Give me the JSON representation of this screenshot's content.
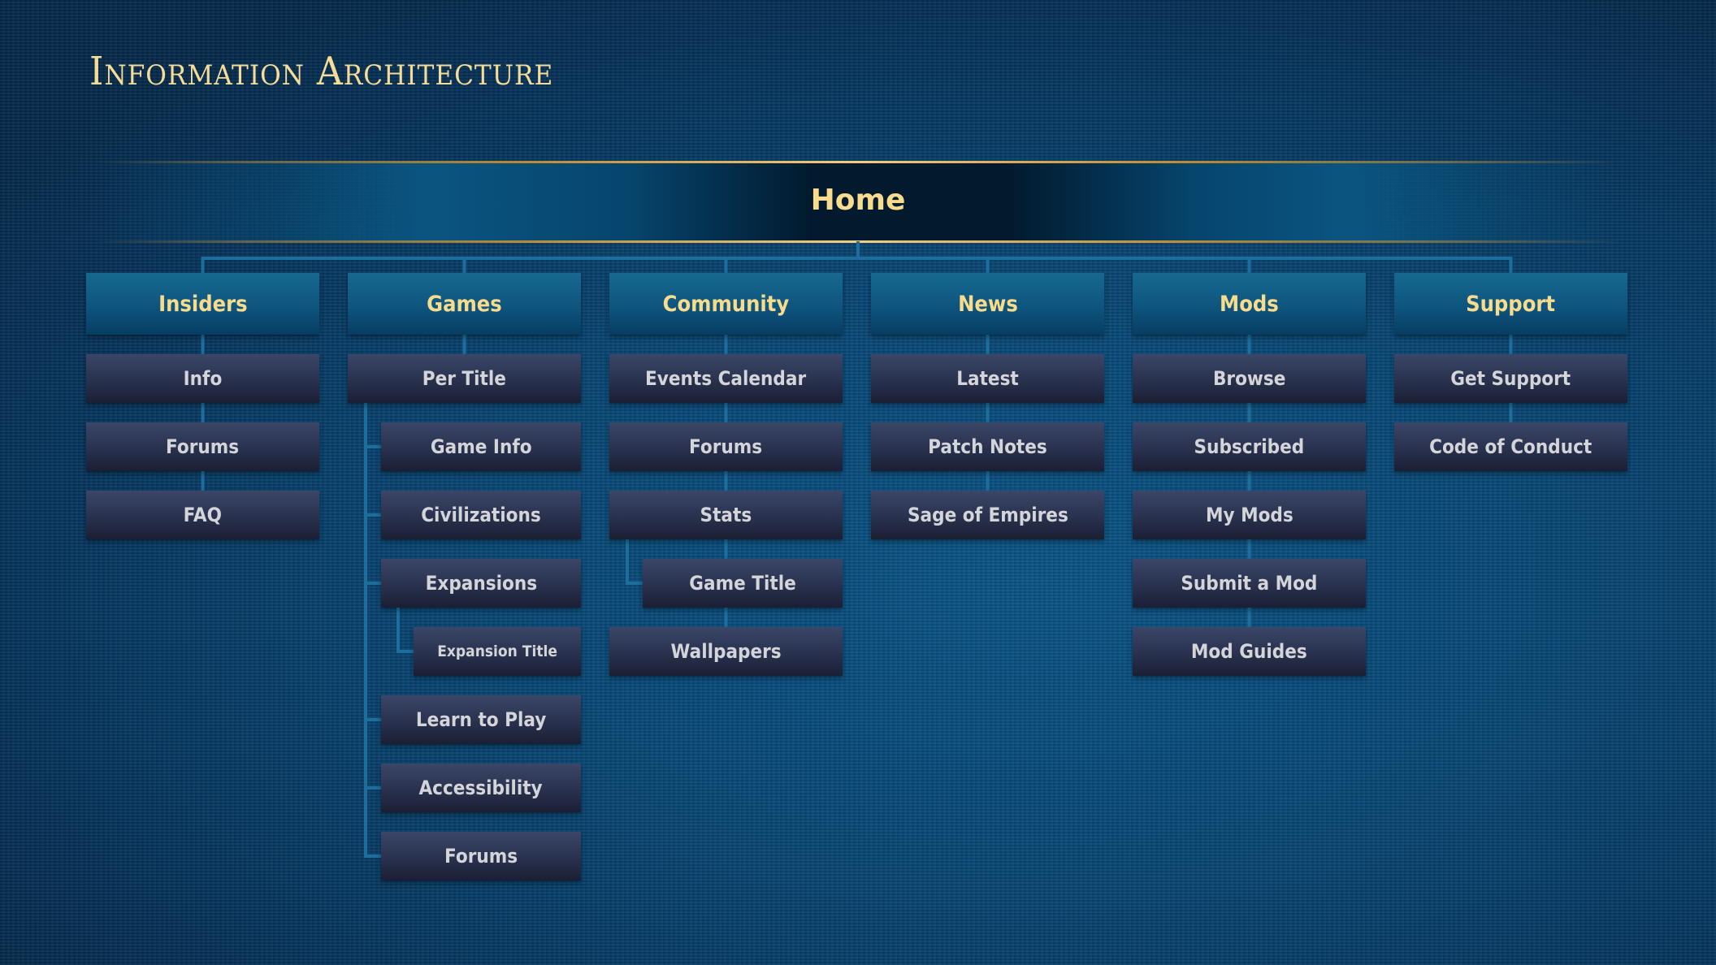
{
  "page": {
    "title": "Information Architecture",
    "root": "Home"
  },
  "colors": {
    "gold_text": "#f8dc8c",
    "child_text": "#d4d5d8",
    "connector": "#1c6e9c",
    "background": "#0a4c7c"
  },
  "sections": [
    {
      "label": "Insiders",
      "items": [
        {
          "label": "Info",
          "depth": 0
        },
        {
          "label": "Forums",
          "depth": 0
        },
        {
          "label": "FAQ",
          "depth": 0
        }
      ]
    },
    {
      "label": "Games",
      "items": [
        {
          "label": "Per Title",
          "depth": 0
        },
        {
          "label": "Game Info",
          "depth": 1
        },
        {
          "label": "Civilizations",
          "depth": 1
        },
        {
          "label": "Expansions",
          "depth": 1
        },
        {
          "label": "Expansion Title",
          "depth": 2
        },
        {
          "label": "Learn to Play",
          "depth": 1
        },
        {
          "label": "Accessibility",
          "depth": 1
        },
        {
          "label": "Forums",
          "depth": 1
        }
      ]
    },
    {
      "label": "Community",
      "items": [
        {
          "label": "Events Calendar",
          "depth": 0
        },
        {
          "label": "Forums",
          "depth": 0
        },
        {
          "label": "Stats",
          "depth": 0
        },
        {
          "label": "Game Title",
          "depth": 1
        },
        {
          "label": "Wallpapers",
          "depth": 0
        }
      ]
    },
    {
      "label": "News",
      "items": [
        {
          "label": "Latest",
          "depth": 0
        },
        {
          "label": "Patch Notes",
          "depth": 0
        },
        {
          "label": "Sage of Empires",
          "depth": 0
        }
      ]
    },
    {
      "label": "Mods",
      "items": [
        {
          "label": "Browse",
          "depth": 0
        },
        {
          "label": "Subscribed",
          "depth": 0
        },
        {
          "label": "My Mods",
          "depth": 0
        },
        {
          "label": "Submit a Mod",
          "depth": 0
        },
        {
          "label": "Mod Guides",
          "depth": 0
        }
      ]
    },
    {
      "label": "Support",
      "items": [
        {
          "label": "Get Support",
          "depth": 0
        },
        {
          "label": "Code of Conduct",
          "depth": 0
        }
      ]
    }
  ]
}
